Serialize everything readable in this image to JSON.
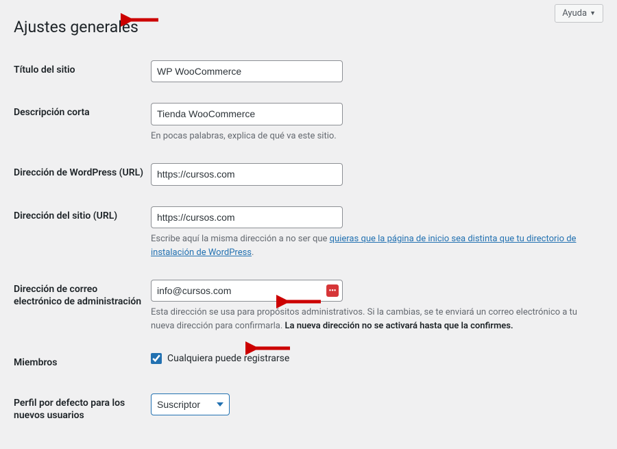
{
  "help": {
    "label": "Ayuda"
  },
  "page": {
    "title": "Ajustes generales"
  },
  "fields": {
    "site_title": {
      "label": "Título del sitio",
      "value": "WP WooCommerce"
    },
    "tagline": {
      "label": "Descripción corta",
      "value": "Tienda WooCommerce",
      "description": "En pocas palabras, explica de qué va este sitio."
    },
    "wp_url": {
      "label": "Dirección de WordPress (URL)",
      "value": "https://cursos.com"
    },
    "site_url": {
      "label": "Dirección del sitio (URL)",
      "value": "https://cursos.com",
      "description_prefix": "Escribe aquí la misma dirección a no ser que ",
      "description_link": "quieras que la página de inicio sea distinta que tu directorio de instalación de WordPress",
      "description_suffix": "."
    },
    "admin_email": {
      "label": "Dirección de correo electrónico de administración",
      "value": "info@cursos.com",
      "description_part1": "Esta dirección se usa para propósitos administrativos. Si la cambias, se te enviará un correo electrónico a tu nueva dirección para confirmarla. ",
      "description_bold": "La nueva dirección no se activará hasta que la confirmes."
    },
    "membership": {
      "label": "Miembros",
      "checkbox_label": "Cualquiera puede registrarse"
    },
    "default_role": {
      "label": "Perfil por defecto para los nuevos usuarios",
      "value": "Suscriptor"
    }
  }
}
